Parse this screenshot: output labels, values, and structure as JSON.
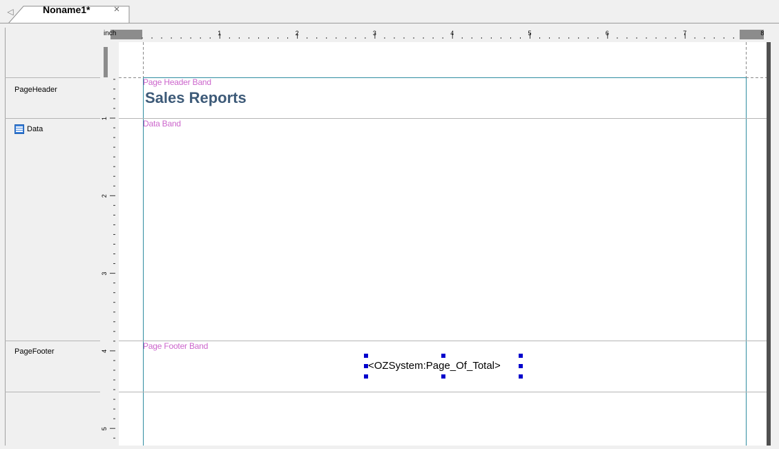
{
  "tab": {
    "title": "Noname1*",
    "close_glyph": "×",
    "scroll_glyph": "◁"
  },
  "ruler": {
    "unit": "inch",
    "horizontal_ticks": [
      "1",
      "2",
      "3",
      "4",
      "5",
      "6",
      "7",
      "8"
    ],
    "vertical_ticks": [
      "1",
      "2",
      "3",
      "4",
      "5"
    ]
  },
  "bands_list": [
    {
      "label": "PageHeader",
      "icon": ""
    },
    {
      "label": "Data",
      "icon": "data-band-icon"
    },
    {
      "label": "PageFooter",
      "icon": ""
    }
  ],
  "report": {
    "page_header_band_title": "Page Header Band",
    "header_text": "Sales Reports",
    "data_band_title": "Data Band",
    "page_footer_band_title": "Page Footer Band",
    "footer_field": "<OZSystem:Page_Of_Total>"
  },
  "colors": {
    "band_title": "#cc66cc",
    "header_text": "#3d5a78",
    "selection_handle": "#0000cc",
    "margin_guide": "#2e8ba0"
  }
}
